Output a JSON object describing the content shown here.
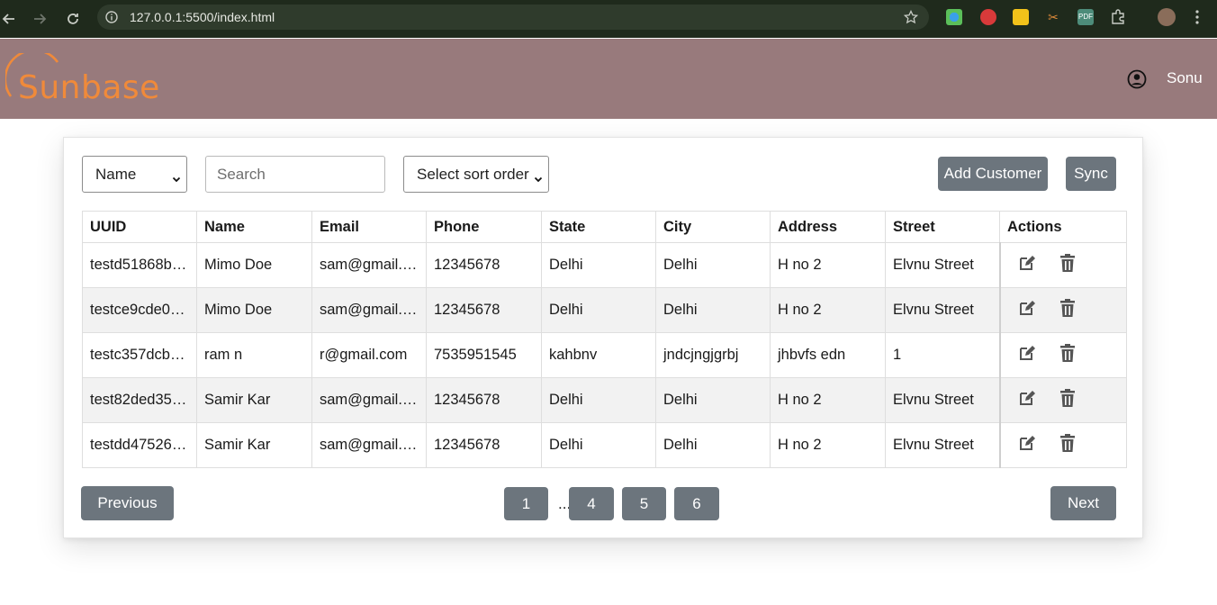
{
  "browser": {
    "url": "127.0.0.1:5500/index.html"
  },
  "header": {
    "logo_text": "Sunbase",
    "user_name": "Sonu"
  },
  "toolbar": {
    "filter_select": "Name",
    "search_placeholder": "Search",
    "sort_select": "Select sort order",
    "add_label": "Add Customer",
    "sync_label": "Sync"
  },
  "table": {
    "columns": [
      "UUID",
      "Name",
      "Email",
      "Phone",
      "State",
      "City",
      "Address",
      "Street",
      "Actions"
    ],
    "rows": [
      [
        "testd51868b…",
        "Mimo Doe",
        "sam@gmail.…",
        "12345678",
        "Delhi",
        "Delhi",
        "H no 2",
        "Elvnu Street"
      ],
      [
        "testce9cde0…",
        "Mimo Doe",
        "sam@gmail.…",
        "12345678",
        "Delhi",
        "Delhi",
        "H no 2",
        "Elvnu Street"
      ],
      [
        "testc357dcbf…",
        "ram n",
        "r@gmail.com",
        "7535951545",
        "kahbnv",
        "jndcjngjgrbj",
        "jhbvfs edn",
        "1"
      ],
      [
        "test82ded35…",
        "Samir Kar",
        "sam@gmail.…",
        "12345678",
        "Delhi",
        "Delhi",
        "H no 2",
        "Elvnu Street"
      ],
      [
        "testdd47526…",
        "Samir Kar",
        "sam@gmail.…",
        "12345678",
        "Delhi",
        "Delhi",
        "H no 2",
        "Elvnu Street"
      ]
    ]
  },
  "pagination": {
    "previous_label": "Previous",
    "next_label": "Next",
    "pages": [
      "1",
      "4",
      "5",
      "6"
    ],
    "ellipsis": "..."
  },
  "colors": {
    "header_bg": "#987a7c",
    "button_bg": "#6c757d",
    "logo": "#f08a3a"
  }
}
